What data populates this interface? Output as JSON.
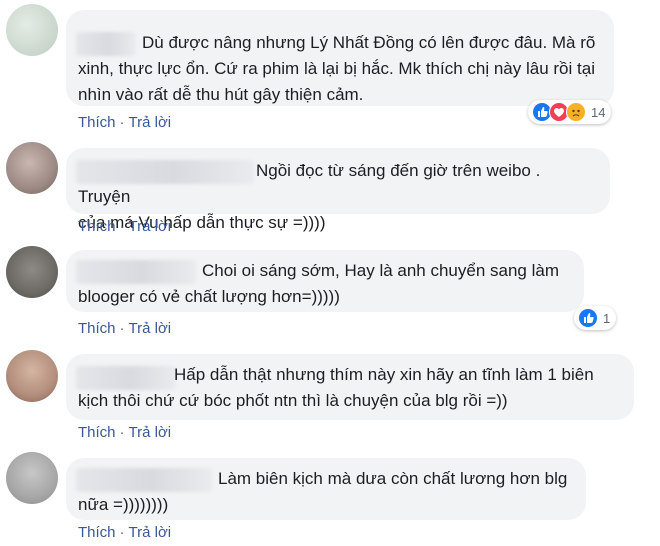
{
  "comments": [
    {
      "text": "Dù được nâng nhưng Lý Nhất Đồng có lên được đâu. Mà rõ\nxinh, thực lực ổn. Cứ ra phim là lại bị hắc. Mk thích chị này lâu rồi tại\nnhìn vào rất dễ thu hút gây thiện cảm.",
      "like_label": "Thích",
      "reply_label": "Trả lời",
      "reaction_count": "14"
    },
    {
      "text": "Ngồi đọc từ sáng đến giờ trên weibo . Truyện\ncủa má Vu hấp dẫn thực sự =))))",
      "like_label": "Thích",
      "reply_label": "Trả lời"
    },
    {
      "text": "Choi oi sáng sớm, Hay là anh chuyển sang làm\nblooger có vẻ chất lượng hơn=)))))",
      "like_label": "Thích",
      "reply_label": "Trả lời",
      "reaction_count": "1"
    },
    {
      "text": "Hấp dẫn thật nhưng thím này xin hãy an tĩnh làm 1 biên\nkịch thôi chứ cứ bóc phốt ntn thì là chuyện của blg rồi =))",
      "like_label": "Thích",
      "reply_label": "Trả lời"
    },
    {
      "text": "Làm biên kịch mà dưa còn chất lương hơn blg\nnữa =))))))))",
      "like_label": "Thích",
      "reply_label": "Trả lời"
    }
  ],
  "colors": {
    "bubble": "#f2f3f5",
    "link": "#385898",
    "like_blue": "#1877f2",
    "love_red": "#f33e58",
    "sad_yellow": "#f7b125"
  },
  "icons": [
    "like-reaction-icon",
    "love-reaction-icon",
    "sad-reaction-icon"
  ]
}
